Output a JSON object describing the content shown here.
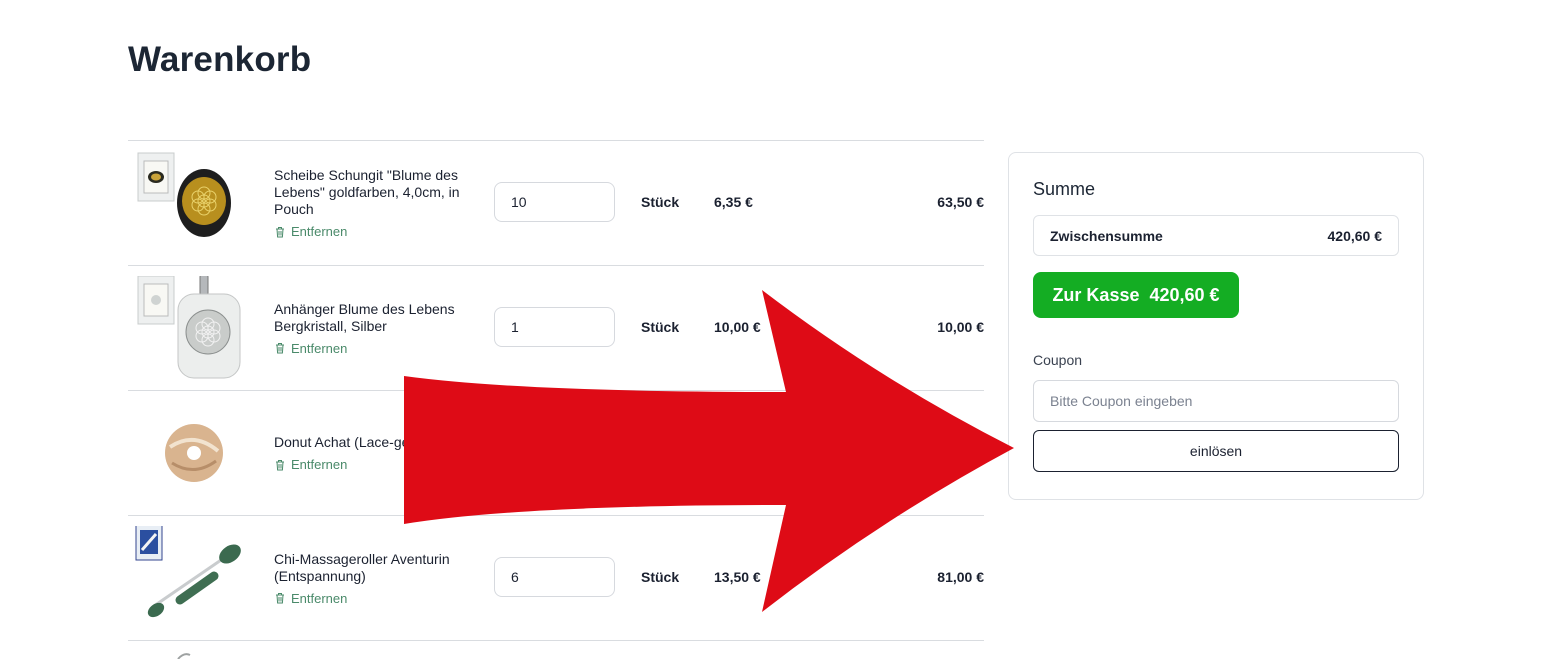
{
  "page": {
    "title": "Warenkorb"
  },
  "cart": {
    "items": [
      {
        "name": "Scheibe Schungit \"Blume des Lebens\" goldfarben, 4,0cm, in Pouch",
        "quantity": "10",
        "unit": "Stück",
        "unit_price": "6,35 €",
        "total": "63,50 €",
        "remove_label": "Entfernen"
      },
      {
        "name": "Anhänger Blume des Lebens Bergkristall, Silber",
        "quantity": "1",
        "unit": "Stück",
        "unit_price": "10,00 €",
        "total": "10,00 €",
        "remove_label": "Entfernen"
      },
      {
        "name": "Donut Achat (Lace-gelb), 30mm",
        "quantity": "",
        "unit": "",
        "unit_price": "",
        "total": "",
        "remove_label": "Entfernen"
      },
      {
        "name": "Chi-Massageroller Aventurin (Entspannung)",
        "quantity": "6",
        "unit": "Stück",
        "unit_price": "13,50 €",
        "total": "81,00 €",
        "remove_label": "Entfernen"
      }
    ]
  },
  "summary": {
    "title": "Summe",
    "subtotal_label": "Zwischensumme",
    "subtotal_value": "420,60 €",
    "checkout_label": "Zur Kasse",
    "checkout_total": "420,60 €",
    "coupon_label": "Coupon",
    "coupon_placeholder": "Bitte Coupon eingeben",
    "redeem_label": "einlösen"
  },
  "colors": {
    "accent_green": "#14ad23",
    "remove_link": "#4a8a6a",
    "overlay_arrow": "#de0b16"
  },
  "icons": [
    "trash-icon",
    "red-arrow-annotation"
  ]
}
